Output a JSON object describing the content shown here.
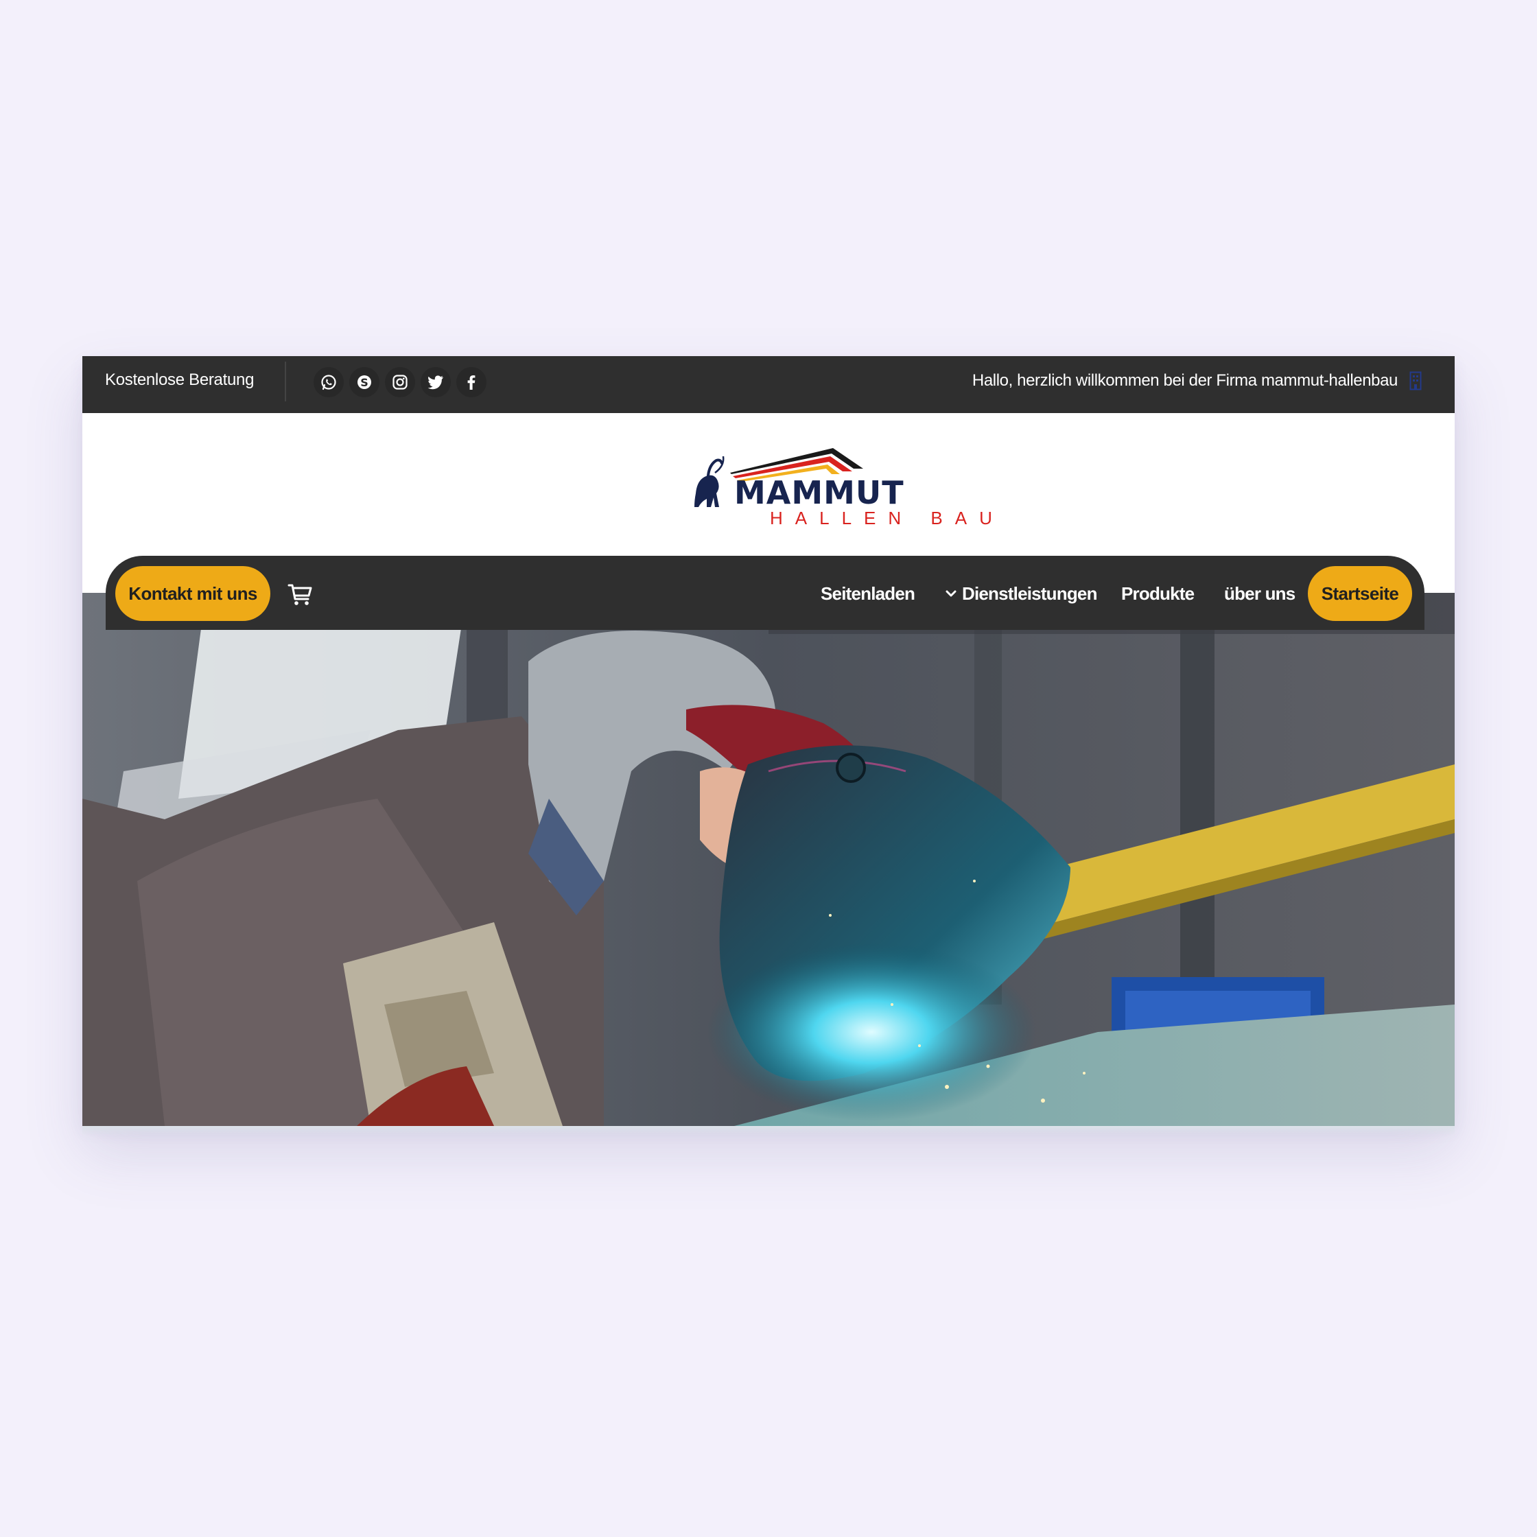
{
  "topbar": {
    "left_text": "Kostenlose Beratung",
    "welcome_text": "Hallo, herzlich willkommen bei der Firma mammut-hallenbau",
    "social_icons": [
      "whatsapp-icon",
      "skype-icon",
      "instagram-icon",
      "twitter-icon",
      "facebook-icon"
    ]
  },
  "logo": {
    "brand": "MAMMUT",
    "sub": "HALLEN BAU"
  },
  "nav": {
    "contact_label": "Kontakt mit uns",
    "items": [
      "Seitenladen",
      "Dienstleistungen",
      "Produkte",
      "über uns"
    ],
    "active_label": "Startseite"
  },
  "colors": {
    "accent": "#eeaa17",
    "bar": "#2f2f2f",
    "brand_navy": "#17244f",
    "brand_red": "#d9231f",
    "page_bg": "#f3f0fb"
  }
}
